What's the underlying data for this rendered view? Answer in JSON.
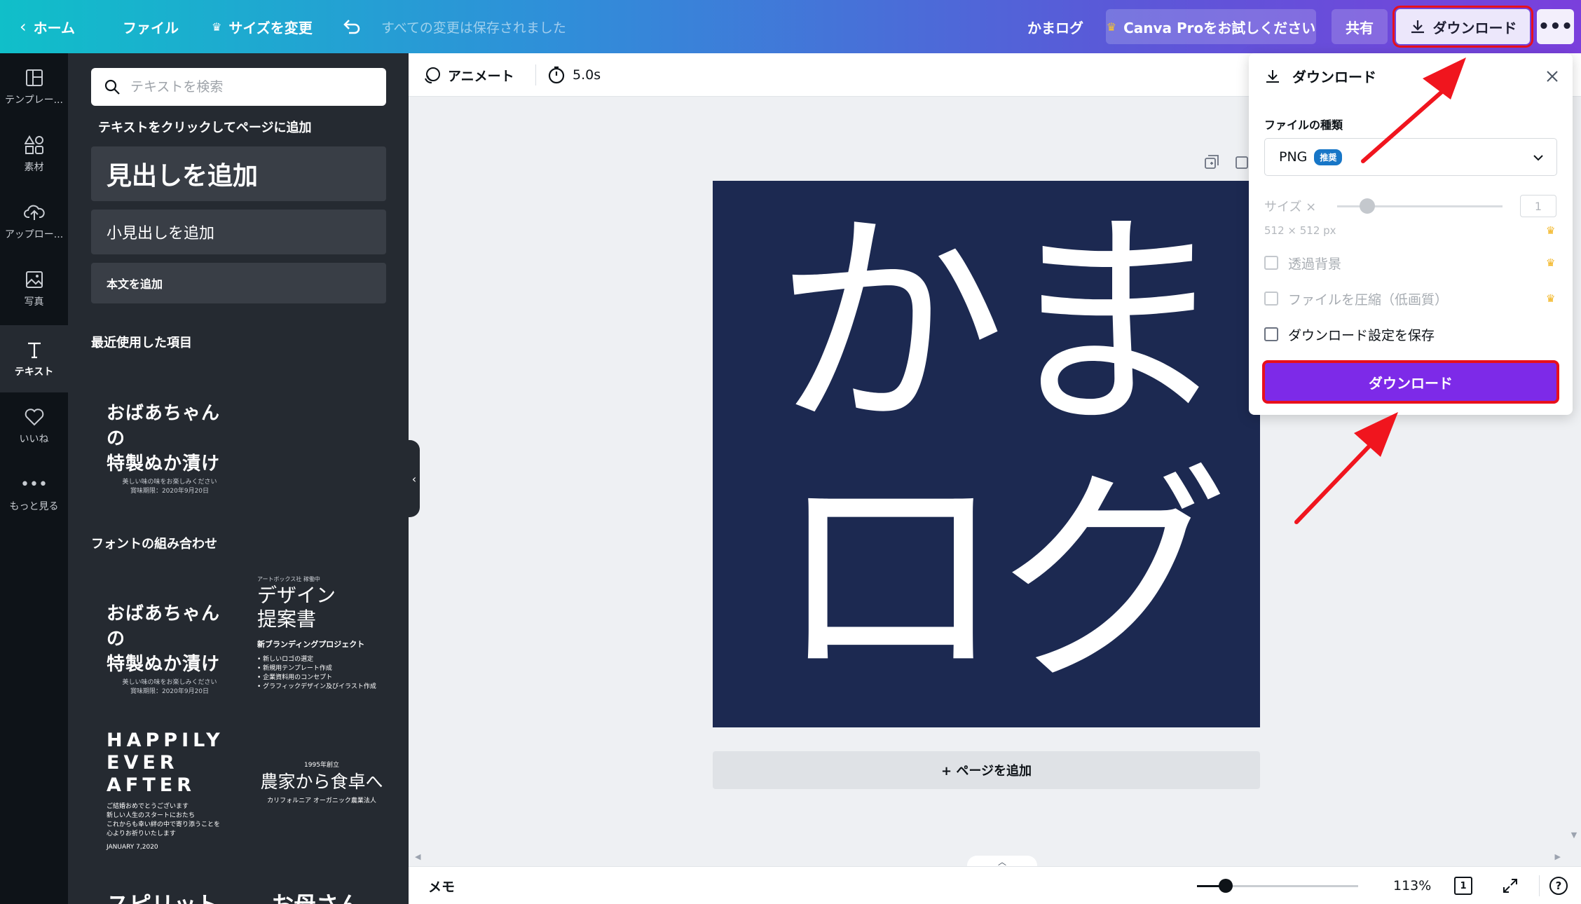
{
  "topbar": {
    "home": "ホーム",
    "file": "ファイル",
    "resize": "サイズを変更",
    "saved_status": "すべての変更は保存されました",
    "doc_title": "かまログ",
    "pro_trial": "Canva Proをお試しください",
    "share": "共有",
    "download": "ダウンロード",
    "more": "•••"
  },
  "rail": {
    "items": [
      {
        "label": "テンプレー...",
        "icon": "template-icon"
      },
      {
        "label": "素材",
        "icon": "elements-icon"
      },
      {
        "label": "アップロー...",
        "icon": "upload-cloud-icon"
      },
      {
        "label": "写真",
        "icon": "photo-icon"
      },
      {
        "label": "テキスト",
        "icon": "text-icon",
        "active": true
      },
      {
        "label": "いいね",
        "icon": "heart-icon"
      },
      {
        "label": "もっと見る",
        "icon": "more-dots-icon"
      }
    ]
  },
  "panel": {
    "search_placeholder": "テキストを検索",
    "click_hint": "テキストをクリックしてページに追加",
    "add_heading": "見出しを追加",
    "add_subheading": "小見出しを追加",
    "add_body": "本文を追加",
    "recent_label": "最近使用した項目",
    "font_combos_label": "フォントの組み合わせ",
    "templates": {
      "brush_1": "おばあちゃんの",
      "brush_2": "特製ぬか漬け",
      "brush_small_1": "美しい味の味をお楽しみください",
      "brush_small_2": "賞味期限：2020年9月20日",
      "design_top": "アートボックス社 稼働中",
      "design_1": "デザイン",
      "design_2": "提案書",
      "design_sub": "新ブランディングプロジェクト",
      "design_bullets": [
        "新しいロゴの選定",
        "新規用テンプレート作成",
        "企業資料用のコンセプト",
        "グラフィックデザイン及びイラスト作成"
      ],
      "happily_1": "HAPPILY",
      "happily_2": "EVER",
      "happily_3": "AFTER",
      "happily_small_1": "ご結婚おめでとうございます",
      "happily_small_2": "新しい人生のスタートにおたち",
      "happily_small_3": "これからも幸い絆の中で寄り添うことを",
      "happily_small_4": "心よりお祈りいたします",
      "happily_date": "JANUARY 7,2020",
      "farm_year": "1995年創立",
      "farm_title": "農家から食卓へ",
      "farm_sub": "カリフォルニア オーガニック農業法人",
      "spirit": "スピリット",
      "mother": "お母さん"
    }
  },
  "canvas": {
    "animate": "アニメート",
    "duration": "5.0s",
    "page_line1": "かま",
    "page_line2": "ログ",
    "page_bg": "#1c2951",
    "add_page": "+ ページを追加"
  },
  "bottombar": {
    "notes": "メモ",
    "zoom_pct": "113%",
    "zoom_level": 0.18,
    "page_count": "1",
    "help": "?"
  },
  "download_popover": {
    "title": "ダウンロード",
    "file_type_label": "ファイルの種類",
    "file_type_value": "PNG",
    "recommended_badge": "推奨",
    "size_label": "サイズ ×",
    "size_value": "1",
    "dimensions": "512 × 512 px",
    "option_transparent": "透過背景",
    "option_compress": "ファイルを圧縮（低画質）",
    "option_save_settings": "ダウンロード設定を保存",
    "download_button": "ダウンロード",
    "highlight_color": "#e8101c",
    "button_color": "#7d2ae8"
  }
}
